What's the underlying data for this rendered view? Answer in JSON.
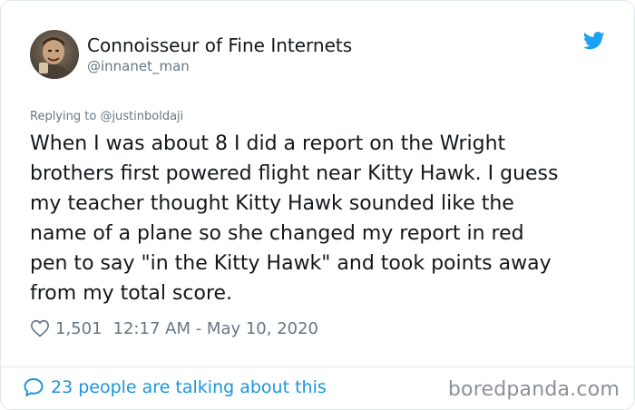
{
  "author": {
    "display_name": "Connoisseur of Fine Internets",
    "handle": "@innanet_man"
  },
  "reply": {
    "prefix": "Replying to ",
    "target": "@justinboldaji"
  },
  "tweet": {
    "text": "When I was about 8 I did a report on the Wright\nbrothers first powered flight near Kitty Hawk. I guess\nmy teacher thought Kitty Hawk sounded like the\nname of a plane so she changed my report in red\npen to say \"in the Kitty Hawk\" and took points away\nfrom my total score."
  },
  "meta": {
    "likes": "1,501",
    "timestamp": "12:17 AM - May 10, 2020"
  },
  "footer": {
    "conversation": "23 people are talking about this"
  },
  "watermark": "boredpanda.com",
  "icons": {
    "brand": "twitter-bird-icon",
    "like": "heart-icon",
    "conversation": "speech-bubble-icon"
  },
  "colors": {
    "twitter_blue": "#1da1f2",
    "link_blue": "#1b95e0",
    "secondary_text": "#657786",
    "primary_text": "#14171a",
    "border": "#e1e8ed"
  }
}
